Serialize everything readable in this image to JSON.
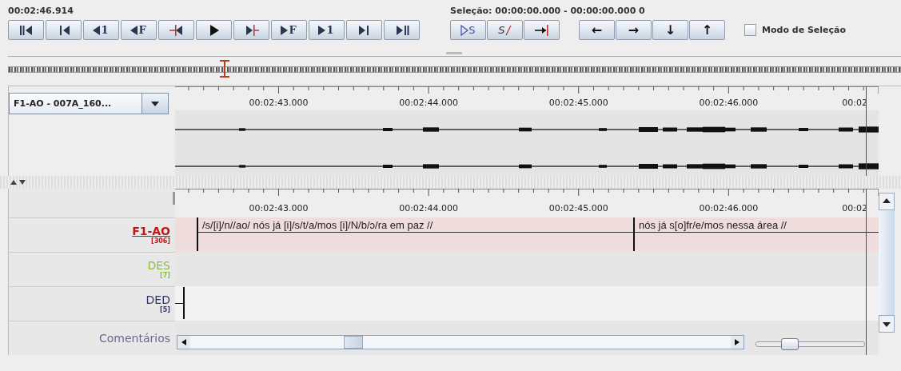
{
  "media_time": "00:02:46.914",
  "selection": {
    "label": "Seleção: 00:00:00.000 - 00:00:00.000  0"
  },
  "transport_buttons": [
    {
      "kind": "bar-back"
    },
    {
      "kind": "line-back"
    },
    {
      "kind": "letter-back",
      "text": "1"
    },
    {
      "kind": "letter-back",
      "text": "F"
    },
    {
      "kind": "mark-back"
    },
    {
      "kind": "play"
    },
    {
      "kind": "mark-forward"
    },
    {
      "kind": "letter-forward",
      "text": "F"
    },
    {
      "kind": "letter-forward",
      "text": "1"
    },
    {
      "kind": "line-forward"
    },
    {
      "kind": "bar-forward"
    }
  ],
  "selection_buttons": [
    {
      "kind": "play-selection",
      "text": "S"
    },
    {
      "kind": "clear-selection",
      "text": "S"
    },
    {
      "kind": "to-end"
    }
  ],
  "arrow_buttons": [
    {
      "text": "←"
    },
    {
      "text": "→"
    },
    {
      "text": "↓"
    },
    {
      "text": "↑"
    }
  ],
  "selection_mode": {
    "label": "Modo de Seleção",
    "checked": false
  },
  "waveform_selector": {
    "value": "F1-AO - 007A_160..."
  },
  "upper_ruler_labels": [
    {
      "label": "00:02:43.000"
    },
    {
      "label": "00:02:44.000"
    },
    {
      "label": "00:02:45.000"
    },
    {
      "label": "00:02:46.000"
    },
    {
      "label": "00:02"
    }
  ],
  "lower_ruler_labels": [
    {
      "label": "00:02:43.000"
    },
    {
      "label": "00:02:44.000"
    },
    {
      "label": "00:02:45.000"
    },
    {
      "label": "00:02:46.000"
    },
    {
      "label": "00:02"
    }
  ],
  "tiers": [
    {
      "name": "F1-AO",
      "count": "[306]",
      "color": "#c01818",
      "active": true,
      "annotations": [
        {
          "kind": "text",
          "text": "/s/[i]/n//ao/ nós já [i]/s/t/a/mos [i]/N/b/ɔ/ra em paz //"
        },
        {
          "kind": "text",
          "text": "nós já s[o]fr/e/mos nessa área //"
        }
      ]
    },
    {
      "name": "DES",
      "count": "[7]",
      "color": "#8cbf3a",
      "active": false
    },
    {
      "name": "DED",
      "count": "[5]",
      "color": "#34346a",
      "active": false,
      "annotations": [
        {
          "kind": "edge"
        }
      ]
    },
    {
      "name": "Comentários",
      "color": "#6a6a90",
      "active": false
    }
  ],
  "zoom": {
    "level": 0.3
  }
}
